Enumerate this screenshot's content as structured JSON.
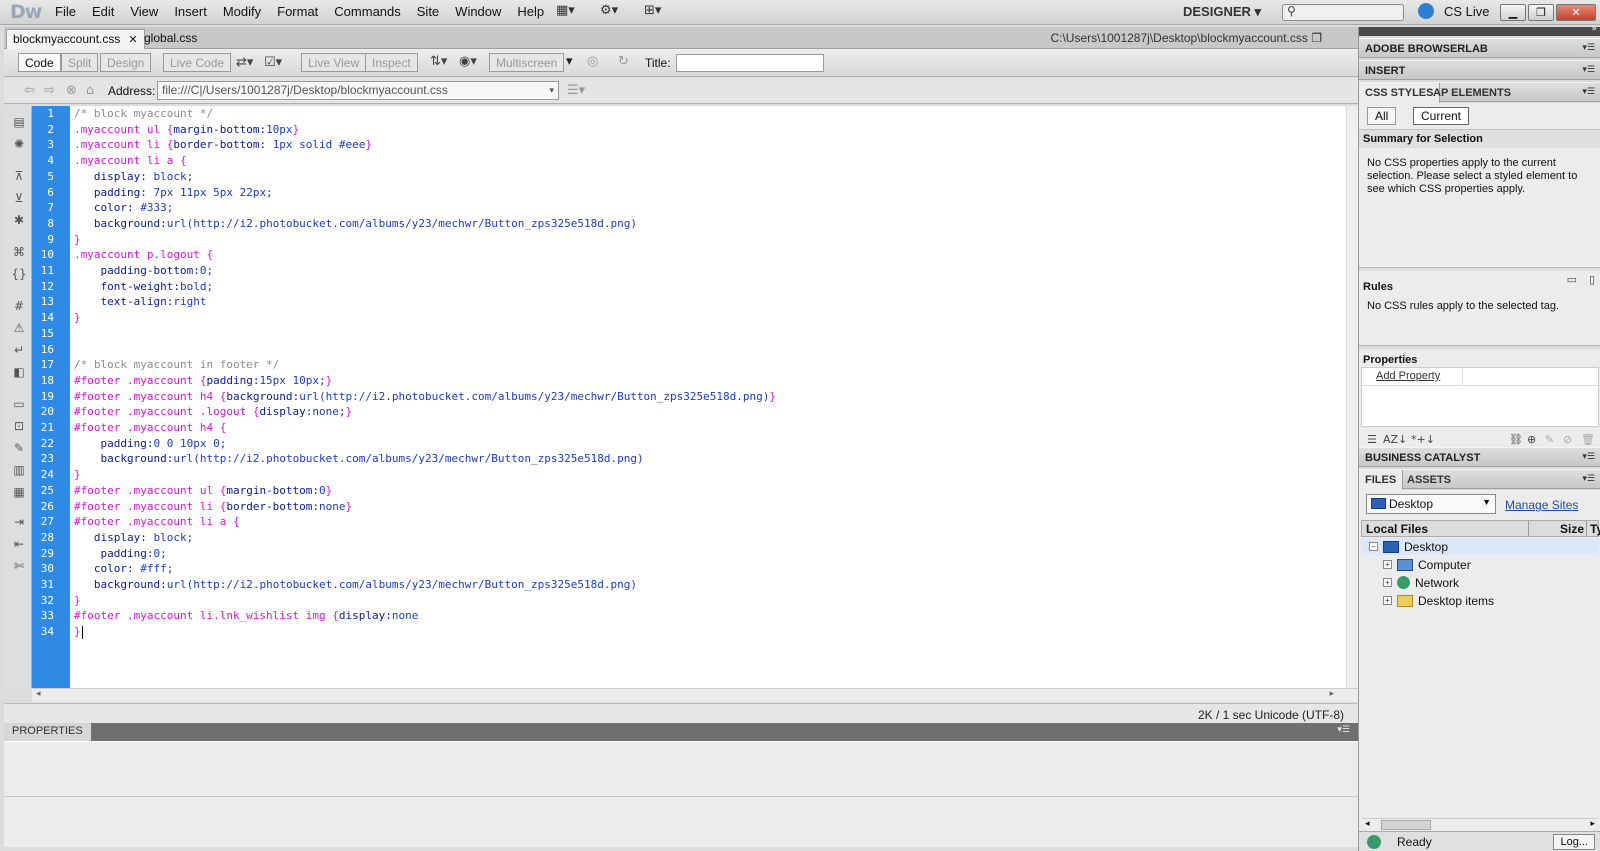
{
  "app": {
    "logo": "Dw",
    "menu": [
      "File",
      "Edit",
      "View",
      "Insert",
      "Modify",
      "Format",
      "Commands",
      "Site",
      "Window",
      "Help"
    ],
    "workspace": "DESIGNER",
    "cs_live": "CS Live"
  },
  "document": {
    "tabs": [
      {
        "label": "blockmyaccount.css",
        "active": true
      },
      {
        "label": "global.css",
        "active": false
      }
    ],
    "path": "C:\\Users\\1001287j\\Desktop\\blockmyaccount.css",
    "view_buttons": [
      "Code",
      "Split",
      "Design",
      "Live Code",
      "Live View",
      "Inspect",
      "Multiscreen"
    ],
    "title_label": "Title:",
    "title_value": "",
    "address_label": "Address:",
    "address_value": "file:///C|/Users/1001287j/Desktop/blockmyaccount.css",
    "status": "2K / 1 sec  Unicode (UTF-8)"
  },
  "code_lines": [
    "/* block myaccount */",
    ".myaccount ul {margin-bottom:10px}",
    ".myaccount li {border-bottom: 1px solid #eee}",
    ".myaccount li a {",
    "   display: block;",
    "   padding: 7px 11px 5px 22px;",
    "   color: #333;",
    "   background:url(http://i2.photobucket.com/albums/y23/mechwr/Button_zps325e518d.png)",
    "}",
    ".myaccount p.logout {",
    "    padding-bottom:0;",
    "    font-weight:bold;",
    "    text-align:right",
    "}",
    "",
    "",
    "/* block myaccount in footer */",
    "#footer .myaccount {padding:15px 10px;}",
    "#footer .myaccount h4 {background:url(http://i2.photobucket.com/albums/y23/mechwr/Button_zps325e518d.png)}",
    "#footer .myaccount .logout {display:none;}",
    "#footer .myaccount h4 {",
    "    padding:0 0 10px 0;",
    "    background:url(http://i2.photobucket.com/albums/y23/mechwr/Button_zps325e518d.png)",
    "}",
    "#footer .myaccount ul {margin-bottom:0}",
    "#footer .myaccount li {border-bottom:none}",
    "#footer .myaccount li a {",
    "   display: block;",
    "    padding:0;",
    "   color: #fff;",
    "   background:url(http://i2.photobucket.com/albums/y23/mechwr/Button_zps325e518d.png)",
    "}",
    "#footer .myaccount li.lnk_wishlist img {display:none",
    "}"
  ],
  "properties_panel": {
    "label": "PROPERTIES"
  },
  "right_panel": {
    "browserlab": "ADOBE BROWSERLAB",
    "insert": "INSERT",
    "css_tabs": [
      "CSS STYLES",
      "AP ELEMENTS"
    ],
    "css_mode_buttons": [
      "All",
      "Current"
    ],
    "summary_title": "Summary for Selection",
    "summary_text": "No CSS properties apply to the current selection.  Please select a styled element to see which CSS properties apply.",
    "rules_title": "Rules",
    "rules_text": "No CSS rules apply to the selected tag.",
    "properties_title": "Properties",
    "add_property": "Add Property",
    "business_catalyst": "BUSINESS CATALYST",
    "files_tabs": [
      "FILES",
      "ASSETS"
    ],
    "site_select": "Desktop",
    "manage_sites": "Manage Sites",
    "columns": [
      "Local Files",
      "Size",
      "Typ"
    ],
    "tree": [
      {
        "label": "Desktop",
        "icon": "desktop-icon"
      },
      {
        "label": "Computer",
        "icon": "computer-icon"
      },
      {
        "label": "Network",
        "icon": "network-icon"
      },
      {
        "label": "Desktop items",
        "icon": "folder-icon"
      }
    ],
    "status": "Ready",
    "log_button": "Log..."
  },
  "colors": {
    "gutter": "#2f8ae6",
    "selector": "#e010e0",
    "comment": "#8c8c8c",
    "property": "#0a1a9a"
  }
}
